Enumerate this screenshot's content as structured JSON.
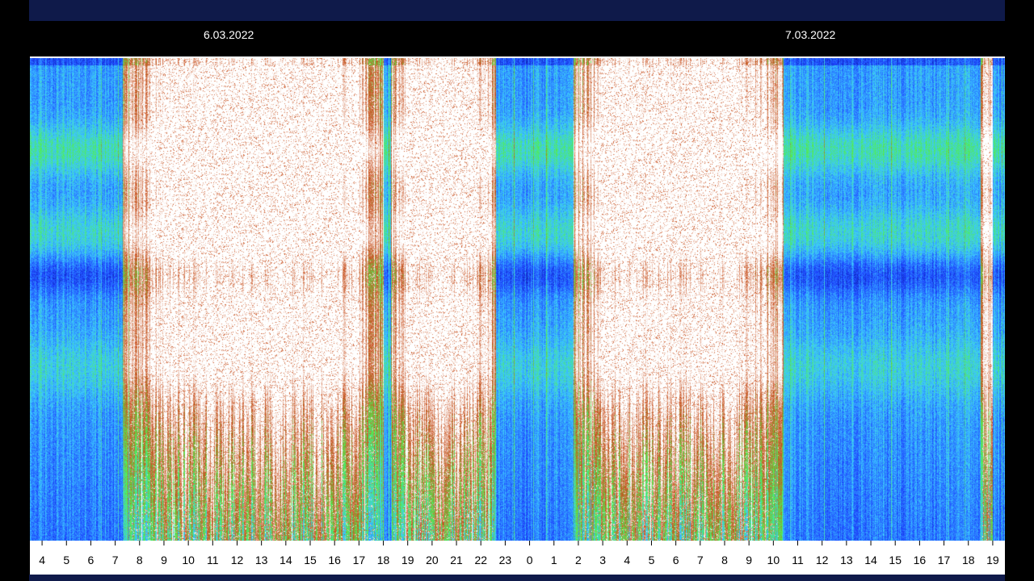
{
  "header": {
    "dates": [
      {
        "label": "6.03.2022"
      },
      {
        "label": "7.03.2022"
      }
    ]
  },
  "chart_data": {
    "type": "heatmap",
    "title": "",
    "xlabel": "",
    "ylabel": "",
    "x_tick_labels": [
      "4",
      "5",
      "6",
      "7",
      "8",
      "9",
      "10",
      "11",
      "12",
      "13",
      "14",
      "15",
      "16",
      "17",
      "18",
      "19",
      "20",
      "21",
      "22",
      "23",
      "0",
      "1",
      "2",
      "3",
      "4",
      "5",
      "6",
      "7",
      "8",
      "9",
      "10",
      "11",
      "12",
      "13",
      "14",
      "15",
      "16",
      "17",
      "18",
      "19"
    ],
    "x_range_hours": [
      3.5,
      43.5
    ],
    "colormap": [
      "#000a78",
      "#1e46ff",
      "#3cc8ff",
      "#50f050",
      "#c8501e",
      "#ffffff"
    ],
    "intensity_bursts": [
      {
        "start_hour": 7.3,
        "end_hour": 18.0,
        "peak": 1.0
      },
      {
        "start_hour": 18.3,
        "end_hour": 22.6,
        "peak": 1.0
      },
      {
        "start_hour": 25.8,
        "end_hour": 34.4,
        "peak": 1.0
      },
      {
        "start_hour": 42.5,
        "end_hour": 43.0,
        "peak": 0.8
      }
    ]
  }
}
